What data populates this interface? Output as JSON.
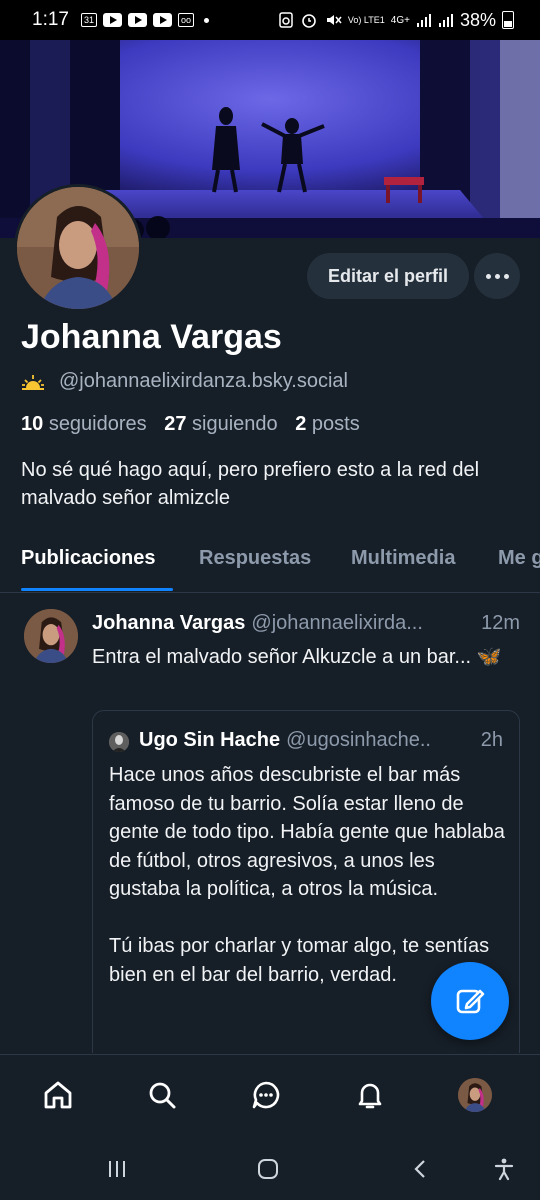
{
  "status_bar": {
    "time": "1:17",
    "calendar_day": "31",
    "network": "Vo) LTE1",
    "network_type": "4G+",
    "battery": "38%"
  },
  "profile": {
    "name": "Johanna Vargas",
    "handle": "@johannaelixirdanza.bsky.social",
    "handle_emoji": "sunrise-icon",
    "followers_count": "10",
    "followers_label": "seguidores",
    "following_count": "27",
    "following_label": "siguiendo",
    "posts_count": "2",
    "posts_label": "posts",
    "bio": "No sé qué hago aquí, pero prefiero esto a la red del malvado señor almizcle",
    "edit_button": "Editar el perfil"
  },
  "tabs": [
    {
      "label": "Publicaciones",
      "active": true
    },
    {
      "label": "Respuestas",
      "active": false
    },
    {
      "label": "Multimedia",
      "active": false
    },
    {
      "label": "Me g",
      "active": false
    }
  ],
  "post": {
    "author": "Johanna Vargas",
    "handle": "@johannaelixirda...",
    "time": "12m",
    "text": "Entra el malvado señor Alkuzcle a un bar... 🦋",
    "quote": {
      "author": "Ugo Sin Hache",
      "handle": "@ugosinhache..",
      "time": "2h",
      "text": "Hace unos años descubriste el bar más famoso de tu barrio. Solía estar lleno de gente de todo tipo. Había gente que hablaba de fútbol, otros agresivos, a unos les gustaba la política, a otros la música.\n\nTú ibas por charlar y tomar algo, te sentías bien en el bar del barrio, verdad."
    }
  },
  "colors": {
    "background": "#161e27",
    "accent": "#1083fe",
    "muted_text": "#8d9aab",
    "button_bg": "#25303d"
  }
}
